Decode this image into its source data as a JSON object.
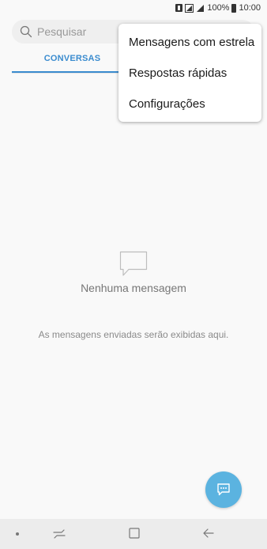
{
  "status_bar": {
    "battery": "100%",
    "time": "10:00"
  },
  "search": {
    "placeholder": "Pesquisar"
  },
  "tabs": [
    {
      "label": "CONVERSAS",
      "active": true
    }
  ],
  "overflow_menu": {
    "items": [
      {
        "label": "Mensagens com estrela"
      },
      {
        "label": "Respostas rápidas"
      },
      {
        "label": "Configurações"
      }
    ]
  },
  "empty_state": {
    "title": "Nenhuma mensagem",
    "subtitle": "As mensagens enviadas serão exibidas aqui."
  },
  "colors": {
    "accent": "#3b8ccf",
    "fab": "#5bb3e0",
    "background": "#f9f9f9"
  },
  "icons": {
    "search": "search-icon",
    "empty": "speech-bubble-icon",
    "fab": "compose-message-icon",
    "nav": [
      "recents-icon",
      "home-icon",
      "back-icon"
    ]
  }
}
